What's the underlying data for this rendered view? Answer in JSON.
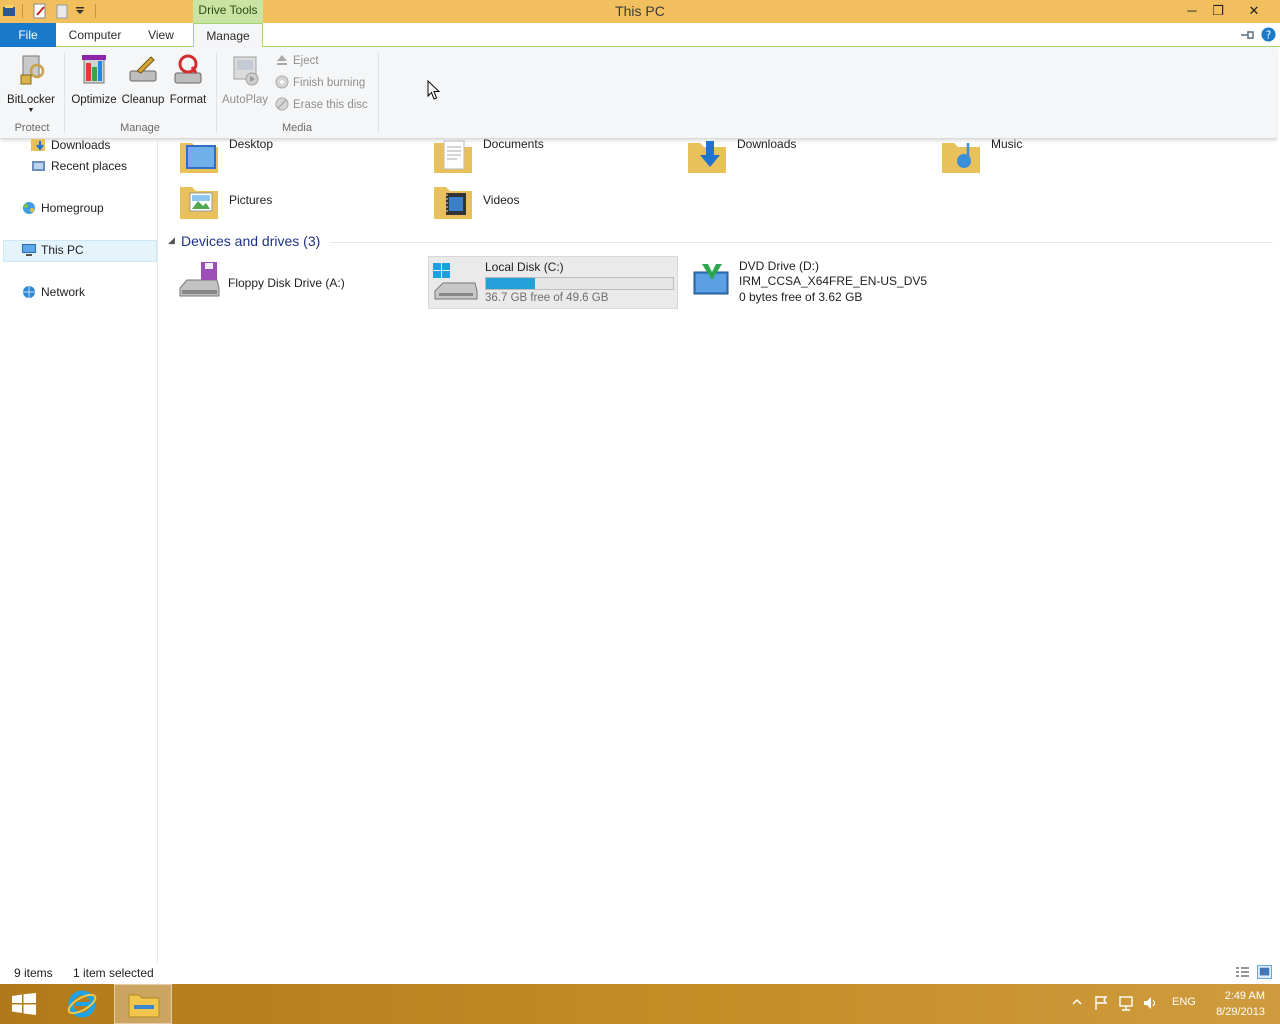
{
  "window": {
    "title": "This PC",
    "context_tab": "Drive Tools",
    "controls": {
      "minimize": "─",
      "restore": "❐",
      "close": "✕"
    }
  },
  "tabs": [
    "File",
    "Computer",
    "View",
    "Manage"
  ],
  "ribbon": {
    "protect": {
      "bitlocker": "BitLocker",
      "group": "Protect"
    },
    "manage": {
      "optimize": "Optimize",
      "cleanup": "Cleanup",
      "format": "Format",
      "group": "Manage"
    },
    "media": {
      "autoplay": "AutoPlay",
      "eject": "Eject",
      "finish_burning": "Finish burning",
      "erase_disc": "Erase this disc",
      "group": "Media"
    }
  },
  "nav": {
    "downloads": "Downloads",
    "recent_places": "Recent places",
    "homegroup": "Homegroup",
    "this_pc": "This PC",
    "network": "Network"
  },
  "folders": [
    "Desktop",
    "Documents",
    "Downloads",
    "Music",
    "Pictures",
    "Videos"
  ],
  "devices": {
    "header": "Devices and drives (3)",
    "floppy": {
      "name": "Floppy Disk Drive (A:)"
    },
    "local_disk": {
      "name": "Local Disk (C:)",
      "free_text": "36.7 GB free of 49.6 GB",
      "used_fraction": 0.26
    },
    "dvd": {
      "name": "DVD Drive (D:)",
      "label": "IRM_CCSA_X64FRE_EN-US_DV5",
      "free_text": "0 bytes free of 3.62 GB"
    }
  },
  "status": {
    "count": "9 items",
    "selection": "1 item selected"
  },
  "taskbar": {
    "lang": "ENG",
    "time": "2:49 AM",
    "date": "8/29/2013"
  },
  "colors": {
    "titlebar": "#f2bf5f",
    "drive_tools": "#c9e4a2",
    "file_tab": "#1979ca",
    "taskbar": "#c58d26",
    "usage_bar": "#26a0da"
  }
}
